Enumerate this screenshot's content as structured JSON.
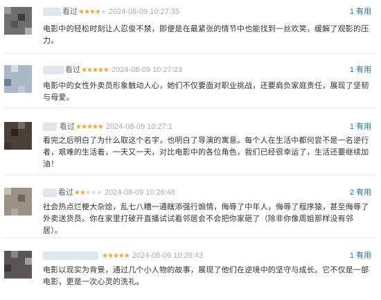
{
  "reviews": [
    {
      "rated_label": "看过",
      "stars": 4,
      "date": "2024-08-09 10:27:35",
      "useful": "1 有用",
      "text": "电影中的轻松时刻让人忍俊不禁，即便是在最紧张的情节中也能找到一丝欢笑，缓解了观影的压力。"
    },
    {
      "rated_label": "看过",
      "stars": 5,
      "date": "2024-08-09 10:27:23",
      "useful": "1 有用",
      "text": "电影中的女性外卖员形象触动人心，她们不仅要面对职业挑战，还要肩负家庭责任，展现了坚韧与母爱。"
    },
    {
      "rated_label": "看过",
      "stars": 5,
      "date": "2024-08-09 10:27:1",
      "useful": "1 有用",
      "text": "看完之后明白了为什么取这个名字，也明白了导演的寓意。每个人在生活中都何尝不是一名逆行者，艰难的生活着，一天又一天，对比电影中的各位角色，我们已经很幸运了，生活还要继续加油！"
    },
    {
      "rated_label": "看过",
      "stars": 2,
      "date": "2024-08-09 10:26:46",
      "useful": "2 有用",
      "text": "社会热点烂梗大杂烩，乱七八糟一通瞎添强行煽情，侮辱了中年人，侮辱了程序猿，甚至侮辱了外卖送货员。你在家里打破开直播试试看邻居会不会把你家砸了（除非你像周姐那样没有邻居）。"
    },
    {
      "rated_label": "",
      "stars": 5,
      "date": "2024-08-09 10:26:43",
      "useful": "1 有用",
      "text": "电影以现实为背景，通过几个小人物的故事，展现了他们在逆境中的坚守与成长。它不仅是一部电影，更是一次心灵的洗礼。"
    }
  ],
  "colors": {
    "star": "#f5a623",
    "link": "#1b70c9",
    "date": "#aaaaaa"
  },
  "icons": {
    "star": "star-icon"
  }
}
